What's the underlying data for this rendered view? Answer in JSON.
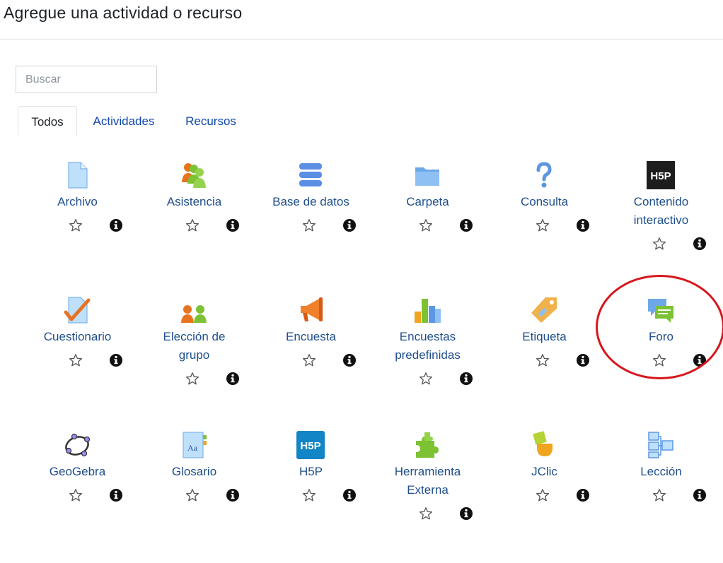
{
  "header": {
    "title": "Agregue una actividad o recurso"
  },
  "search": {
    "placeholder": "Buscar",
    "value": ""
  },
  "tabs": [
    {
      "label": "Todos",
      "active": true
    },
    {
      "label": "Actividades",
      "active": false
    },
    {
      "label": "Recursos",
      "active": false
    }
  ],
  "modules": [
    {
      "label": "Archivo",
      "icon": "file-icon"
    },
    {
      "label": "Asistencia",
      "icon": "attendance-icon"
    },
    {
      "label": "Base de datos",
      "icon": "database-icon"
    },
    {
      "label": "Carpeta",
      "icon": "folder-icon"
    },
    {
      "label": "Consulta",
      "icon": "question-icon"
    },
    {
      "label": "Contenido interactivo",
      "label_lines": [
        "Contenido",
        "interactivo"
      ],
      "icon": "h5p-black-icon"
    },
    {
      "label": "Cuestionario",
      "icon": "quiz-icon"
    },
    {
      "label": "Elección de grupo",
      "label_lines": [
        "Elección de",
        "grupo"
      ],
      "icon": "group-choice-icon"
    },
    {
      "label": "Encuesta",
      "icon": "megaphone-icon"
    },
    {
      "label": "Encuestas predefinidas",
      "label_lines": [
        "Encuestas",
        "predefinidas"
      ],
      "icon": "survey-chart-icon"
    },
    {
      "label": "Etiqueta",
      "icon": "label-tag-icon"
    },
    {
      "label": "Foro",
      "icon": "forum-icon",
      "highlighted": true
    },
    {
      "label": "GeoGebra",
      "icon": "geogebra-icon"
    },
    {
      "label": "Glosario",
      "icon": "glossary-icon"
    },
    {
      "label": "H5P",
      "icon": "h5p-blue-icon"
    },
    {
      "label": "Herramienta Externa",
      "label_lines": [
        "Herramienta",
        "Externa"
      ],
      "icon": "puzzle-icon"
    },
    {
      "label": "JClic",
      "icon": "jclic-icon"
    },
    {
      "label": "Lección",
      "icon": "lesson-icon"
    }
  ],
  "colors": {
    "link": "#1f4e8c",
    "highlight": "#d6171d",
    "tab_link": "#0f47ad"
  }
}
